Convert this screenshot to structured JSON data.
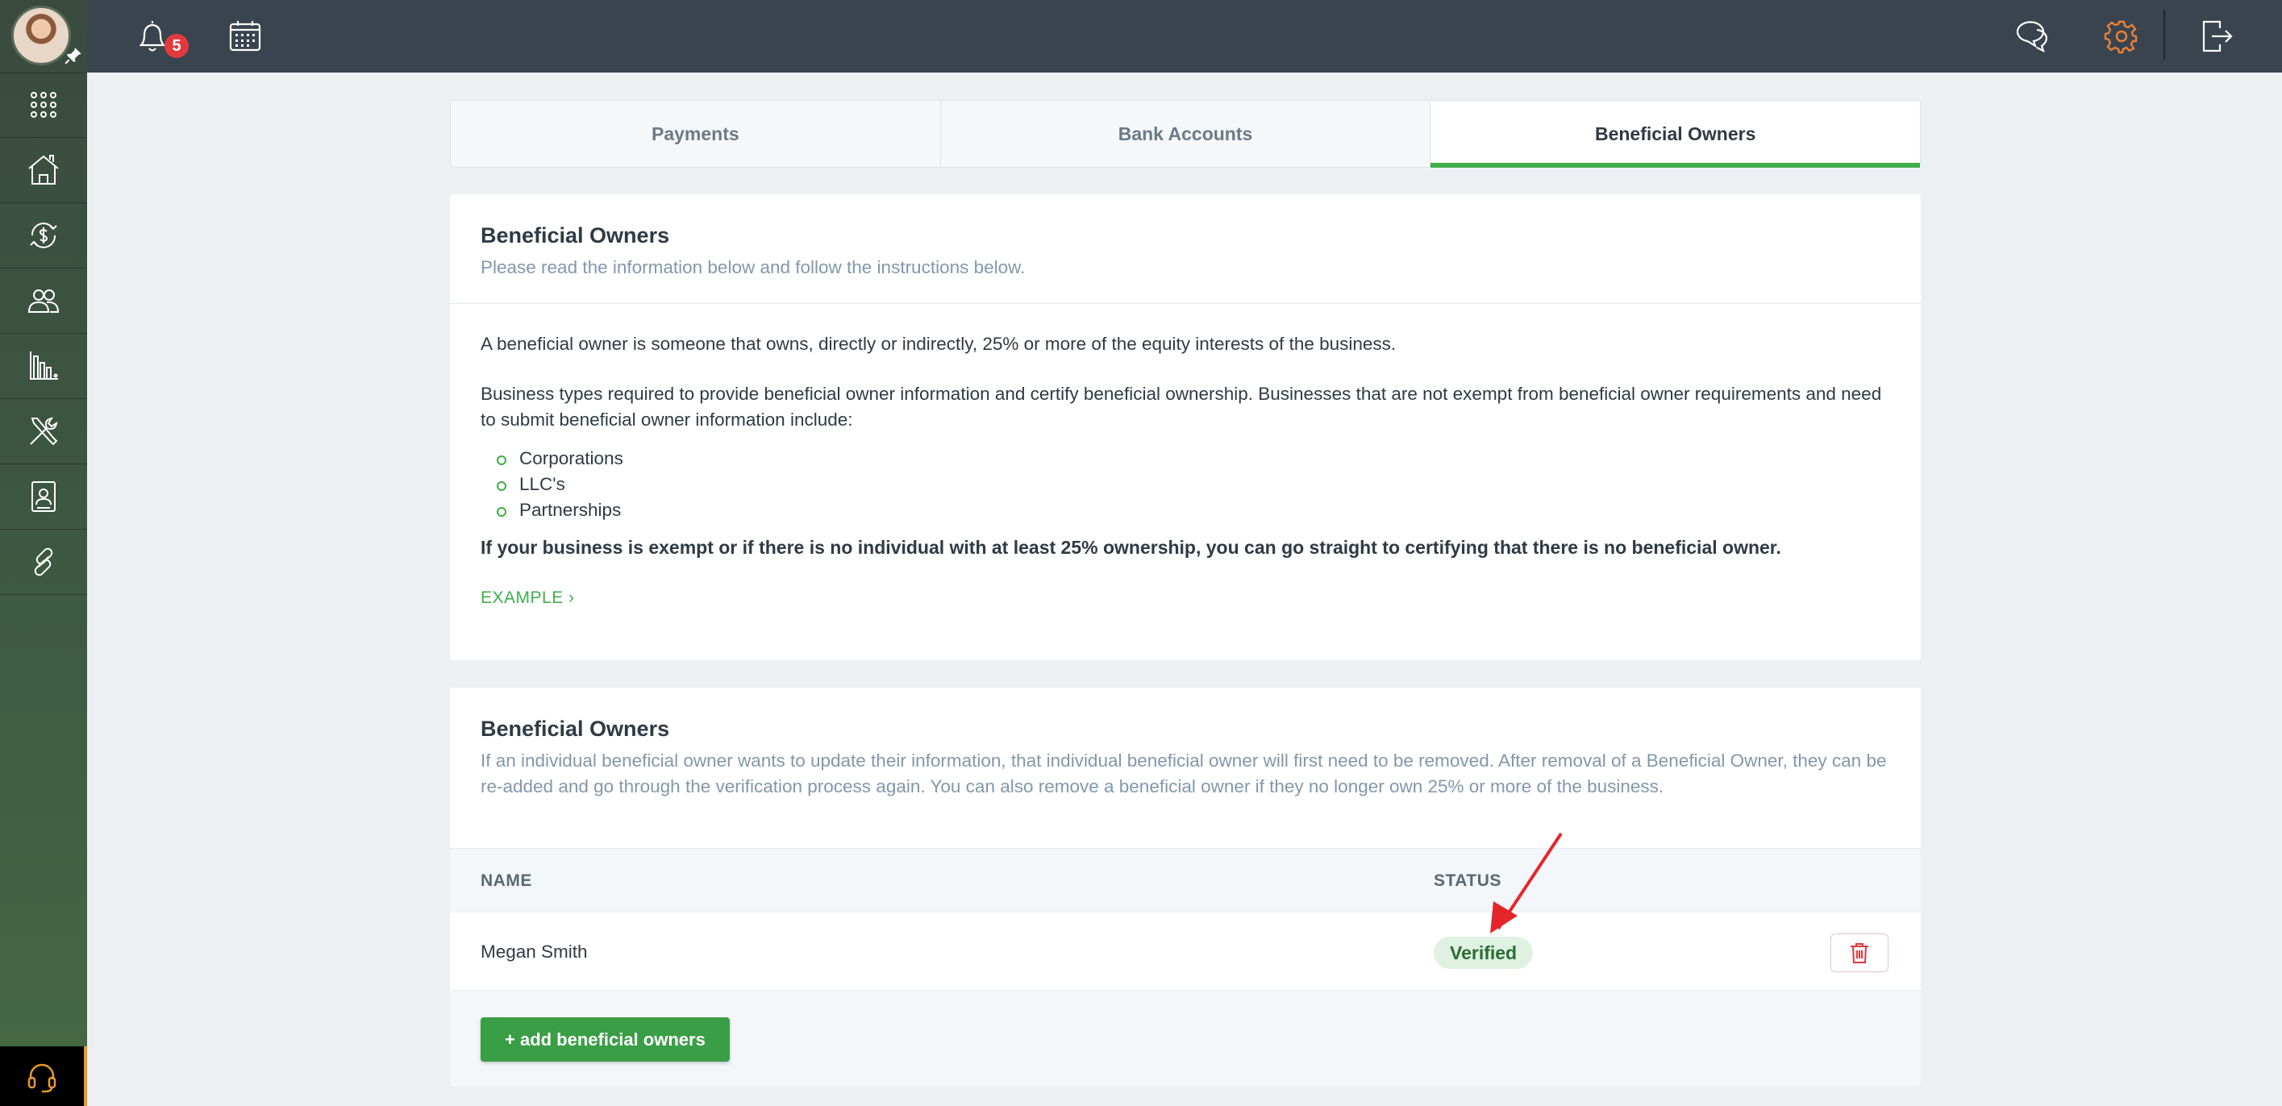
{
  "topbar": {
    "notification_count": "5"
  },
  "tabs": [
    {
      "label": "Payments"
    },
    {
      "label": "Bank Accounts"
    },
    {
      "label": "Beneficial Owners",
      "active": true
    }
  ],
  "info_card": {
    "title": "Beneficial Owners",
    "subtitle": "Please read the information below and follow the instructions below.",
    "paragraph1": "A beneficial owner is someone that owns, directly or indirectly, 25% or more of the equity interests of the business.",
    "paragraph2": "Business types required to provide beneficial owner information and certify beneficial ownership. Businesses that are not exempt from beneficial owner requirements and need to submit beneficial owner information include:",
    "business_types": [
      "Corporations",
      "LLC's",
      "Partnerships"
    ],
    "note": "If your business is exempt or if there is no individual with at least 25% ownership, you can go straight to certifying that there is no beneficial owner.",
    "example_link": "EXAMPLE ›"
  },
  "owners_card": {
    "title": "Beneficial Owners",
    "subtitle": "If an individual beneficial owner wants to update their information, that individual beneficial owner will first need to be removed. After removal of a Beneficial Owner, they can be re-added and go through the verification process again. You can also remove a beneficial owner if they no longer own 25% or more of the business.",
    "columns": {
      "name": "NAME",
      "status": "STATUS"
    },
    "rows": [
      {
        "name": "Megan Smith",
        "status": "Verified"
      }
    ],
    "add_button": "+ add beneficial owners"
  },
  "colors": {
    "accent_green": "#3fae49",
    "topbar": "#3a444f",
    "badge_red": "#e0393e",
    "settings_orange": "#e8823a"
  },
  "icons": {
    "sidebar": [
      "apps-grid-icon",
      "house-icon",
      "money-exchange-icon",
      "users-icon",
      "bar-chart-icon",
      "tools-icon",
      "contact-card-icon",
      "link-icon"
    ],
    "topbar": [
      "bell-icon",
      "calendar-icon",
      "chat-icon",
      "gear-icon",
      "logout-icon"
    ],
    "support": "headset-icon"
  }
}
